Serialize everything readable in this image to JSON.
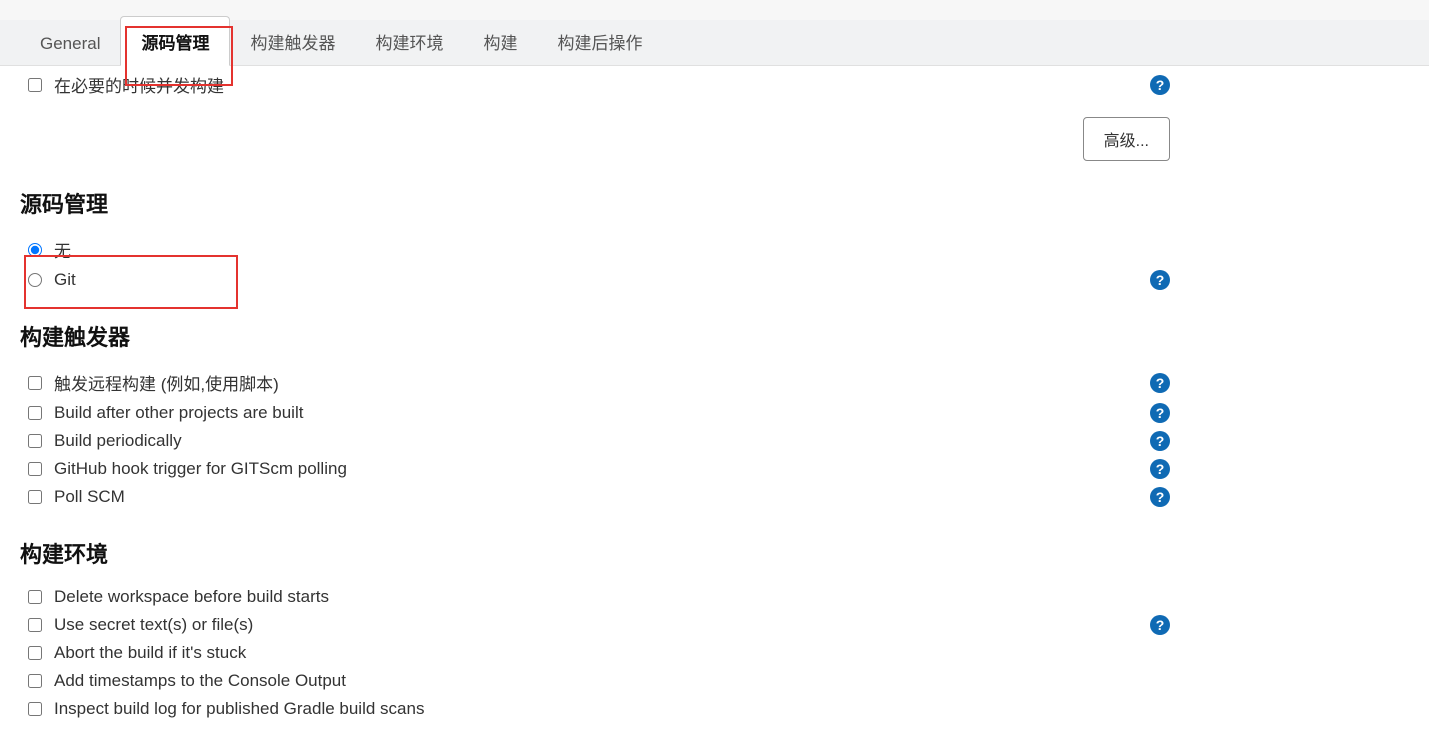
{
  "tabs": {
    "general": "General",
    "scm": "源码管理",
    "triggers": "构建触发器",
    "env": "构建环境",
    "build": "构建",
    "post": "构建后操作"
  },
  "truncatedRow": {
    "label": "在必要的时候并发构建"
  },
  "advancedBtn": "高级...",
  "scmSection": {
    "title": "源码管理",
    "none": "无",
    "git": "Git"
  },
  "triggersSection": {
    "title": "构建触发器",
    "items": [
      "触发远程构建 (例如,使用脚本)",
      "Build after other projects are built",
      "Build periodically",
      "GitHub hook trigger for GITScm polling",
      "Poll SCM"
    ]
  },
  "envSection": {
    "title": "构建环境",
    "items": [
      "Delete workspace before build starts",
      "Use secret text(s) or file(s)",
      "Abort the build if it's stuck",
      "Add timestamps to the Console Output",
      "Inspect build log for published Gradle build scans"
    ]
  },
  "help": "?"
}
